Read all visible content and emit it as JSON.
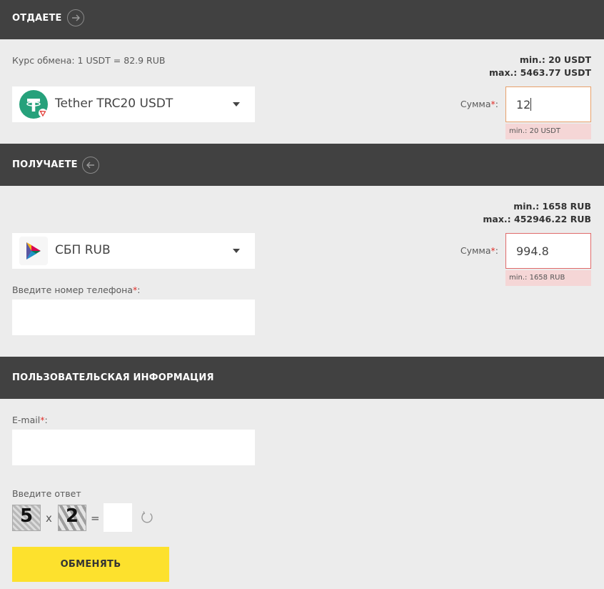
{
  "give": {
    "title": "ОТДАЕТЕ",
    "rate": "Курс обмена: 1 USDT = 82.9 RUB",
    "min": "min.: 20 USDT",
    "max": "max.: 5463.77 USDT",
    "currency": "Tether TRC20 USDT",
    "sum_label": "Сумма",
    "sum_value": "12",
    "error": "min.: 20 USDT"
  },
  "receive": {
    "title": "ПОЛУЧАЕТЕ",
    "min": "min.: 1658 RUB",
    "max": "max.: 452946.22 RUB",
    "currency": "СБП RUB",
    "sum_label": "Сумма",
    "sum_value": "994.8",
    "error": "min.: 1658 RUB",
    "phone_label": "Введите номер телефона"
  },
  "user_info": {
    "title": "ПОЛЬЗОВАТЕЛЬСКАЯ ИНФОРМАЦИЯ",
    "email_label": "E-mail"
  },
  "captcha": {
    "label": "Введите ответ",
    "a": "5",
    "op": "x",
    "b": "2",
    "eq": "="
  },
  "common": {
    "required_mark": "*",
    "colon": ":"
  },
  "submit_label": "ОБМЕНЯТЬ",
  "colors": {
    "header_bg": "#414141",
    "page_bg": "#ececec",
    "accent_button": "#fde12d",
    "error_bg": "#f5d6d6",
    "required": "#e0302a",
    "tether_green": "#26a17b"
  },
  "icons": {
    "give_arrow": "arrow-right-circle-icon",
    "receive_arrow": "arrow-left-circle-icon",
    "tether": "tether-logo-icon",
    "sbp": "sbp-logo-icon",
    "refresh": "refresh-icon"
  }
}
